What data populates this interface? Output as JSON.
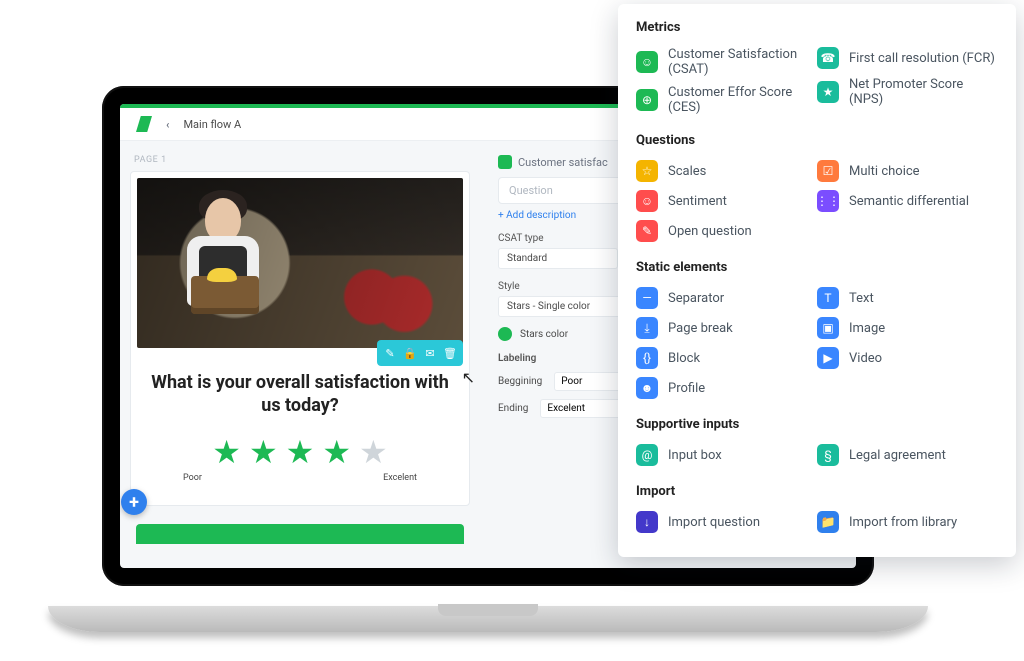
{
  "header": {
    "flow_name": "Main flow A"
  },
  "page_label": "PAGE 1",
  "preview": {
    "question": "What is your overall satisfaction with us today?",
    "scale_low": "Poor",
    "scale_high": "Excelent",
    "stars_filled": 4,
    "stars_total": 5
  },
  "config": {
    "type_name": "Customer satisfac",
    "question_placeholder": "Question",
    "add_description": "+ Add description",
    "csat_type_label": "CSAT type",
    "csat_type_value": "Standard",
    "style_label": "Style",
    "style_value": "Stars - Single color",
    "stars_color_label": "Stars color",
    "labeling_label": "Labeling",
    "beginning_label": "Beggining",
    "beginning_value": "Poor",
    "ending_label": "Ending",
    "ending_value": "Excelent"
  },
  "panel": {
    "metrics_title": "Metrics",
    "metrics": [
      {
        "label": "Customer Satisfaction (CSAT)",
        "color": "ic-green",
        "icon": "☺"
      },
      {
        "label": "First call resolution (FCR)",
        "color": "ic-teal",
        "icon": "☎"
      },
      {
        "label": "Customer Effor Score (CES)",
        "color": "ic-green",
        "icon": "⊕"
      },
      {
        "label": "Net Promoter Score (NPS)",
        "color": "ic-teal",
        "icon": "★"
      }
    ],
    "questions_title": "Questions",
    "questions": [
      {
        "label": "Scales",
        "color": "ic-yellow",
        "icon": "☆"
      },
      {
        "label": "Multi choice",
        "color": "ic-orange",
        "icon": "☑"
      },
      {
        "label": "Sentiment",
        "color": "ic-red",
        "icon": "☺"
      },
      {
        "label": "Semantic differential",
        "color": "ic-purple",
        "icon": "⋮⋮"
      },
      {
        "label": "Open question",
        "color": "ic-red",
        "icon": "✎"
      }
    ],
    "static_title": "Static elements",
    "static": [
      {
        "label": "Separator",
        "color": "ic-blue",
        "icon": "—"
      },
      {
        "label": "Text",
        "color": "ic-blue",
        "icon": "T"
      },
      {
        "label": "Page break",
        "color": "ic-blue",
        "icon": "⤓"
      },
      {
        "label": "Image",
        "color": "ic-blue",
        "icon": "▣"
      },
      {
        "label": "Block",
        "color": "ic-blue",
        "icon": "{}"
      },
      {
        "label": "Video",
        "color": "ic-blue",
        "icon": "▶"
      },
      {
        "label": "Profile",
        "color": "ic-blue",
        "icon": "☻"
      }
    ],
    "supportive_title": "Supportive inputs",
    "supportive": [
      {
        "label": "Input box",
        "color": "ic-teal",
        "icon": "@"
      },
      {
        "label": "Legal agreement",
        "color": "ic-teal",
        "icon": "§"
      }
    ],
    "import_title": "Import",
    "import": [
      {
        "label": "Import question",
        "color": "ic-indigo",
        "icon": "↓"
      },
      {
        "label": "Import from library",
        "color": "ic-blue2",
        "icon": "📁"
      }
    ]
  }
}
